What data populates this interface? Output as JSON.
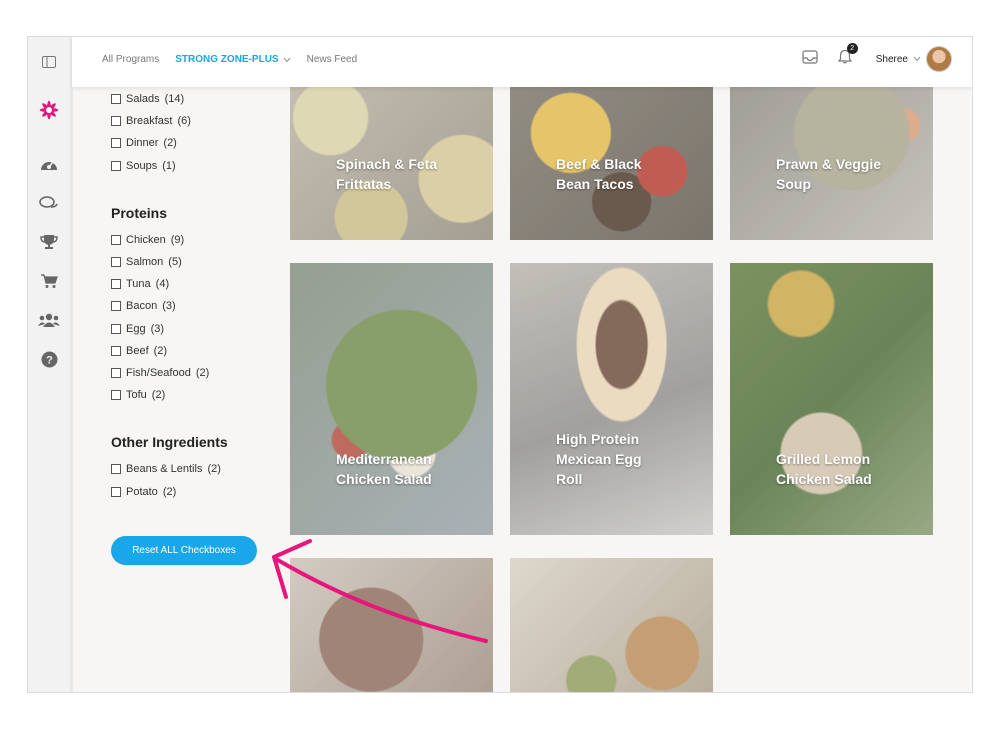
{
  "nav": {
    "all_programs": "All Programs",
    "program": "STRONG ZONE-PLUS",
    "news_feed": "News Feed"
  },
  "notifications_count": "2",
  "user_name": "Sheree",
  "filters": {
    "meal_items": [
      {
        "label": "Salads",
        "count": "(14)"
      },
      {
        "label": "Breakfast",
        "count": "(6)"
      },
      {
        "label": "Dinner",
        "count": "(2)"
      },
      {
        "label": "Soups",
        "count": "(1)"
      }
    ],
    "proteins_title": "Proteins",
    "protein_items": [
      {
        "label": "Chicken",
        "count": "(9)"
      },
      {
        "label": "Salmon",
        "count": "(5)"
      },
      {
        "label": "Tuna",
        "count": "(4)"
      },
      {
        "label": "Bacon",
        "count": "(3)"
      },
      {
        "label": "Egg",
        "count": "(3)"
      },
      {
        "label": "Beef",
        "count": "(2)"
      },
      {
        "label": "Fish/Seafood",
        "count": "(2)"
      },
      {
        "label": "Tofu",
        "count": "(2)"
      }
    ],
    "other_title": "Other Ingredients",
    "other_items": [
      {
        "label": "Beans & Lentils",
        "count": "(2)"
      },
      {
        "label": "Potato",
        "count": "(2)"
      }
    ]
  },
  "reset_label": "Reset ALL Checkboxes",
  "recipes": [
    {
      "line1": "Spinach & Feta",
      "line2": "Frittatas",
      "line3": ""
    },
    {
      "line1": "Beef & Black",
      "line2": "Bean Tacos",
      "line3": ""
    },
    {
      "line1": "Prawn & Veggie",
      "line2": "Soup",
      "line3": ""
    },
    {
      "line1": "Mediterranean",
      "line2": "Chicken Salad",
      "line3": ""
    },
    {
      "line1": "High Protein",
      "line2": "Mexican Egg",
      "line3": "Roll"
    },
    {
      "line1": "Grilled Lemon",
      "line2": "Chicken Salad",
      "line3": ""
    },
    {
      "line1": "",
      "line2": "",
      "line3": ""
    },
    {
      "line1": "",
      "line2": "",
      "line3": ""
    }
  ],
  "colors": {
    "accent": "#1aa7ea",
    "logo": "#e0197d",
    "arrow": "#e8167c"
  },
  "icons": [
    "sidebar-toggle-icon",
    "logo-star-icon",
    "dashboard-icon",
    "chat-icon",
    "trophy-icon",
    "cart-icon",
    "community-icon",
    "help-icon",
    "inbox-icon",
    "bell-icon",
    "chevron-down-icon"
  ]
}
